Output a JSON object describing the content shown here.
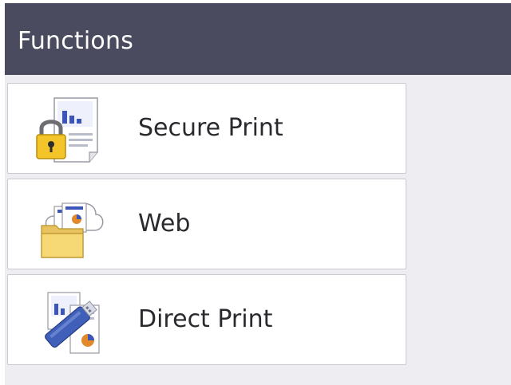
{
  "header": {
    "title": "Functions",
    "background_color": "#4a4b5e"
  },
  "functions": [
    {
      "label": "Secure Print",
      "icon": "secure-print-icon"
    },
    {
      "label": "Web",
      "icon": "web-folder-icon"
    },
    {
      "label": "Direct Print",
      "icon": "usb-direct-print-icon"
    }
  ]
}
